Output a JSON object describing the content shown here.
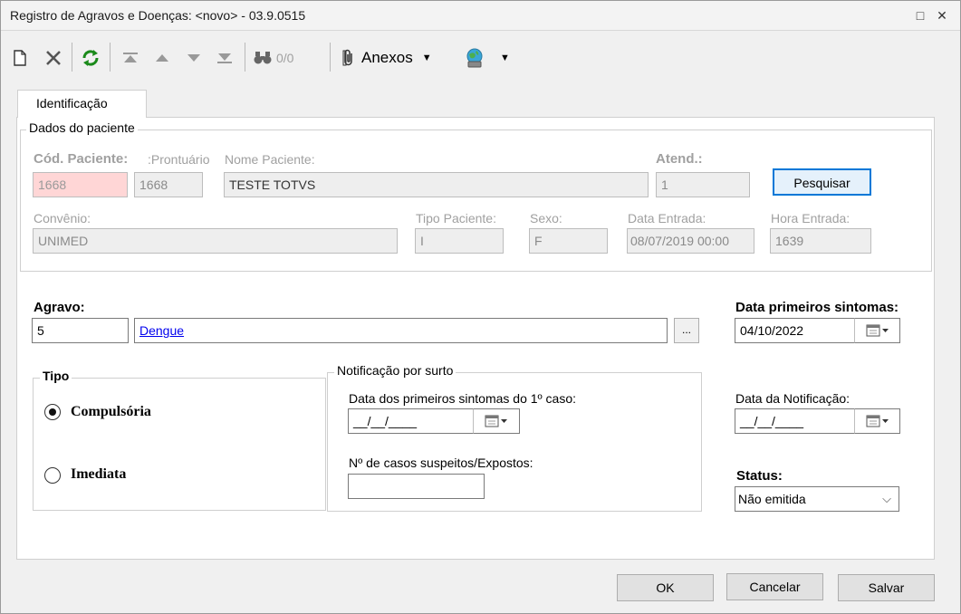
{
  "window": {
    "title": "Registro de Agravos e Doenças: <novo> - 03.9.0515",
    "controls": {
      "restore": "□",
      "close": "✕"
    }
  },
  "toolbar": {
    "record_counter": "0/0",
    "attachments_label": "Anexos"
  },
  "tabs": [
    {
      "label": "Identificação"
    }
  ],
  "patient": {
    "group_title": "Dados do paciente",
    "cod_paciente_label": "Cód. Paciente:",
    "cod_paciente_value": "1668",
    "prontuario_label": "Prontuário:",
    "prontuario_value": "1668",
    "nome_label": "Nome Paciente:",
    "nome_value": "TESTE TOTVS",
    "atend_label": "Atend.:",
    "atend_value": "1",
    "search_label": "Pesquisar",
    "convenio_label": "Convênio:",
    "convenio_value": "UNIMED",
    "tipo_paciente_label": "Tipo Paciente:",
    "tipo_paciente_value": "I",
    "sexo_label": "Sexo:",
    "sexo_value": "F",
    "data_entrada_label": "Data Entrada:",
    "data_entrada_value": "08/07/2019 00:00",
    "hora_entrada_label": "Hora Entrada:",
    "hora_entrada_value": "1639"
  },
  "agravo": {
    "label": "Agravo:",
    "code": "5",
    "name": "Dengue",
    "lookup_label": "...",
    "sintomas_label": "Data primeiros sintomas:",
    "sintomas_value": "04/10/2022"
  },
  "tipo": {
    "title": "Tipo",
    "options": [
      {
        "label": "Compulsória",
        "selected": true
      },
      {
        "label": "Imediata",
        "selected": false
      }
    ]
  },
  "surto": {
    "title": "Notificação por surto",
    "first_case_label": "Data dos primeiros sintomas do 1º caso:",
    "first_case_value": "__/__/____",
    "cases_label": "Nº de casos suspeitos/Expostos:",
    "cases_value": ""
  },
  "notificacao": {
    "label": "Data da Notificação:",
    "value": "__/__/____",
    "status_label": "Status:",
    "status_value": "Não emitida"
  },
  "footer": {
    "ok_label": "OK",
    "cancel_label": "Cancelar",
    "save_label": "Salvar"
  },
  "colors": {
    "accent_border": "#0078d7",
    "link": "#0000ee",
    "required_field": "#ffd6d6"
  }
}
